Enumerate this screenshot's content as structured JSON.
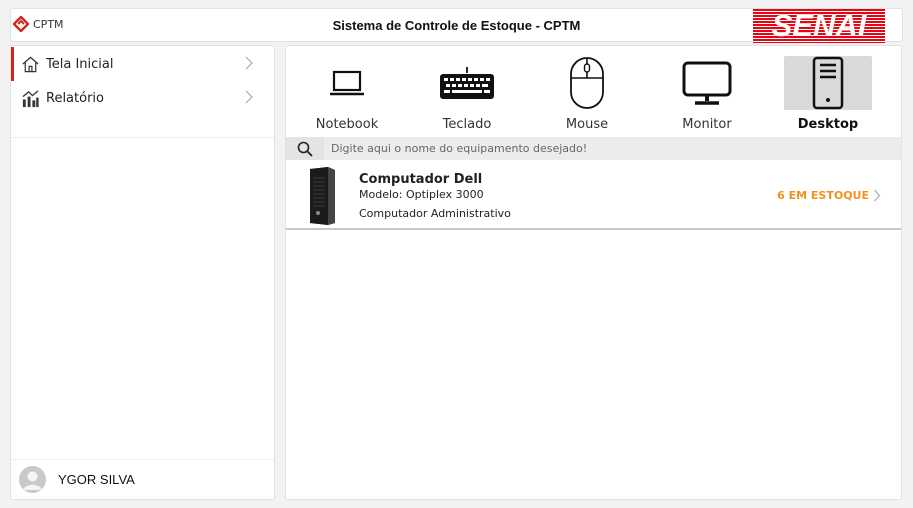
{
  "header": {
    "brand": "CPTM",
    "title": "Sistema de Controle de Estoque - CPTM",
    "partner_logo": "SENAI",
    "colors": {
      "brand_red": "#d0281f",
      "senai_red": "#e30613"
    }
  },
  "sidebar": {
    "items": [
      {
        "label": "Tela Inicial",
        "icon": "home-icon",
        "active": true
      },
      {
        "label": "Relatório",
        "icon": "report-chart-icon",
        "active": false
      }
    ],
    "user": {
      "name": "YGOR SILVA",
      "icon": "user-avatar-icon"
    }
  },
  "categories": [
    {
      "label": "Notebook",
      "icon": "laptop-icon",
      "selected": false
    },
    {
      "label": "Teclado",
      "icon": "keyboard-icon",
      "selected": false
    },
    {
      "label": "Mouse",
      "icon": "mouse-icon",
      "selected": false
    },
    {
      "label": "Monitor",
      "icon": "monitor-icon",
      "selected": false
    },
    {
      "label": "Desktop",
      "icon": "desktop-tower-icon",
      "selected": true
    }
  ],
  "search": {
    "placeholder": "Digite aqui o nome do equipamento desejado!",
    "value": ""
  },
  "results": [
    {
      "name": "Computador Dell",
      "model": "Modelo: Optiplex 3000",
      "department": "Computador Administrativo",
      "stock": "6 EM ESTOQUE",
      "stock_color": "#f0921e"
    }
  ]
}
